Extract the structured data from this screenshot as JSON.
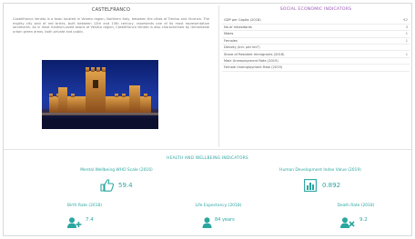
{
  "city": {
    "title": "CASTELFRANCO",
    "description": "Castelfranco Veneto is a town located in Veneto region, Northern Italy, between the cities of Treviso and Vicenza. The mighty city wall of red bricks, built between 12th and 13th century, represents one of its most representative landmarks. As in most medium-sized towns of Veneto region, Castelfranco Veneto is also characterised by remarkable urban green areas, both private and public."
  },
  "socio": {
    "title": "SOCIAL ECONOMIC INDICATORS",
    "rows": [
      {
        "label": "GDP per Capita (2016)",
        "value": "€2"
      },
      {
        "label": "No of Inhabitants",
        "value": "3"
      },
      {
        "label": "Males",
        "value": "1"
      },
      {
        "label": "Females",
        "value": "1"
      },
      {
        "label": "Density (Inh. per km²)",
        "value": ""
      },
      {
        "label": "Share of Resident Immigrants (2016)",
        "value": "1"
      },
      {
        "label": "Male Unemployment Rate (2019)",
        "value": ""
      },
      {
        "label": "Female Unemployment Rate (2019)",
        "value": ""
      }
    ]
  },
  "health": {
    "title": "HEALTH AND WELLBEING INDICATORS",
    "mental": {
      "label": "Mental Wellbeing WHO Scale (2016)",
      "value": "59.4"
    },
    "hdi": {
      "label": "Human Development Index Value (2019)",
      "value": "0.892"
    },
    "birth": {
      "label": "Birth Rate (2018)",
      "value": "7.4"
    },
    "life": {
      "label": "Life Expectancy (2018)",
      "value": "84 years"
    },
    "death": {
      "label": "Death Rate (2018)",
      "value": "9.2"
    }
  },
  "colors": {
    "accent_teal": "#2aa6a0",
    "accent_purple": "#9b59b6"
  },
  "icons": {
    "mental": "thumbs-up-icon",
    "hdi": "bar-chart-icon",
    "birth": "user-plus-icon",
    "life": "user-icon",
    "death": "user-times-icon"
  }
}
